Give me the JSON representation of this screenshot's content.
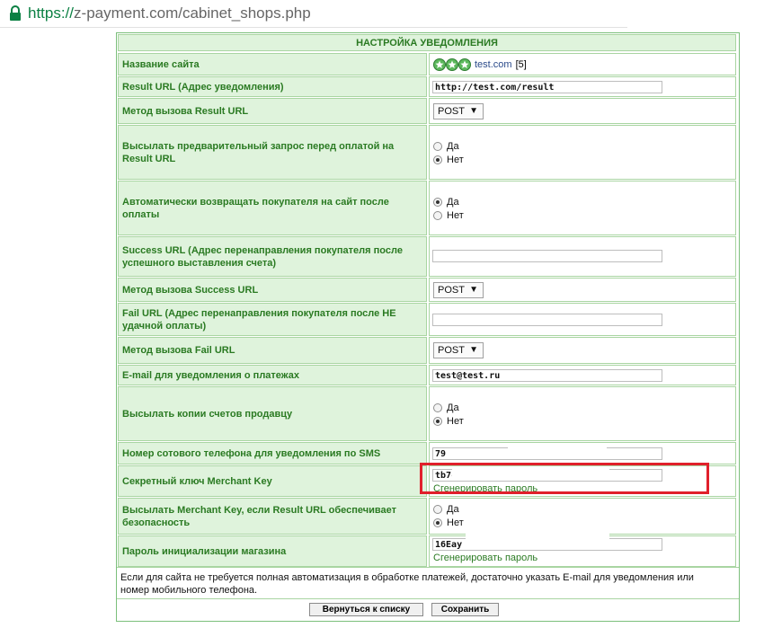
{
  "browser": {
    "url_scheme": "https://",
    "url_rest": "z-payment.com/cabinet_shops.php"
  },
  "form": {
    "title": "НАСТРОЙКА УВЕДОМЛЕНИЯ",
    "site_name_label": "Название сайта",
    "site_name_value": "test.com",
    "site_name_rating": "[5]",
    "result_url_label": "Result URL (Адрес уведомления)",
    "result_url_value": "http://test.com/result",
    "result_method_label": "Метод вызова Result URL",
    "result_method_value": "POST",
    "prerequest_label": "Высылать предварительный запрос перед оплатой на Result URL",
    "prerequest_yes": "Да",
    "prerequest_no": "Нет",
    "prerequest_selected": "no",
    "autoreturn_label": "Автоматически возвращать покупателя на сайт после оплаты",
    "autoreturn_yes": "Да",
    "autoreturn_no": "Нет",
    "autoreturn_selected": "yes",
    "success_url_label": "Success URL (Адрес перенаправления покупателя после успешного выставления счета)",
    "success_url_value": "",
    "success_method_label": "Метод вызова Success URL",
    "success_method_value": "POST",
    "fail_url_label": "Fail URL (Адрес перенаправления покупателя после НЕ удачной оплаты)",
    "fail_url_value": "",
    "fail_method_label": "Метод вызова Fail URL",
    "fail_method_value": "POST",
    "email_label": "E-mail для уведомления о платежах",
    "email_value": "test@test.ru",
    "copies_label": "Высылать копии счетов продавцу",
    "copies_yes": "Да",
    "copies_no": "Нет",
    "copies_selected": "no",
    "phone_label": "Номер сотового телефона для уведомления по SMS",
    "phone_value": "79",
    "merchant_key_label": "Секретный ключ Merchant Key",
    "merchant_key_value": "tb7c",
    "merchant_key_generate": "Сгенерировать пароль",
    "send_key_label": "Высылать Merchant Key, если Result URL обеспечивает безопасность",
    "send_key_yes": "Да",
    "send_key_no": "Нет",
    "send_key_selected": "no",
    "init_password_label": "Пароль инициализации магазина",
    "init_password_value": "16Eay",
    "init_password_generate": "Сгенерировать пароль",
    "note": "Если для сайта не требуется полная автоматизация в обработке платежей, достаточно указать E-mail для уведомления или номер мобильного телефона.",
    "back_button": "Вернуться к списку",
    "save_button": "Сохранить"
  },
  "colors": {
    "label_bg": "#dff3dc",
    "label_text": "#2a7a22",
    "border": "#a9d5a2",
    "highlight": "#e0202b"
  }
}
